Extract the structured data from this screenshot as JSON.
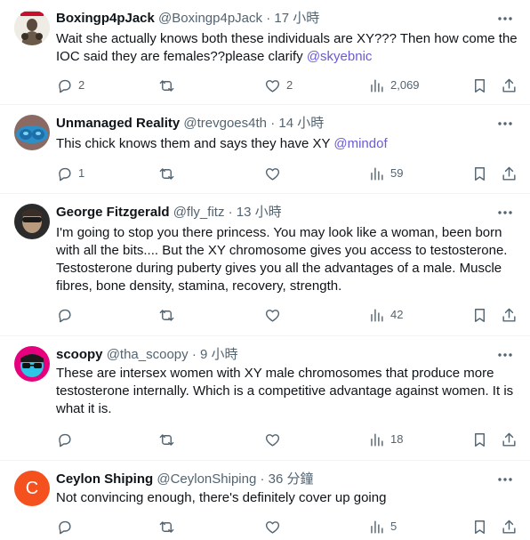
{
  "tweets": [
    {
      "name": "Boxingp4pJack",
      "handle": "@Boxingp4pJack",
      "sep": "·",
      "time": "17 小時",
      "text": "Wait she actually knows both these individuals are XY??? Then how come the IOC said they are females??please clarify ",
      "mention": "@skyebnic",
      "replies": "2",
      "retweets": "",
      "likes": "2",
      "views": "2,069"
    },
    {
      "name": "Unmanaged Reality",
      "handle": "@trevgoes4th",
      "sep": "·",
      "time": "14 小時",
      "text": "This chick knows them and says they have XY ",
      "mention": "@mindof",
      "replies": "1",
      "retweets": "",
      "likes": "",
      "views": "59"
    },
    {
      "name": "George Fitzgerald",
      "handle": "@fly_fitz",
      "sep": "·",
      "time": "13 小時",
      "text": "I'm going to stop you there princess. You may look like a woman, been born with all the bits.... But the XY chromosome gives you access to testosterone. Testosterone during puberty gives you all the advantages of a male. Muscle fibres, bone density, stamina, recovery, strength.",
      "mention": "",
      "replies": "",
      "retweets": "",
      "likes": "",
      "views": "42"
    },
    {
      "name": "scoopy",
      "handle": "@tha_scoopy",
      "sep": "·",
      "time": "9 小時",
      "text": "These are intersex women with XY male chromosomes that produce more testosterone internally. Which is a competitive advantage against women. It is what it is.",
      "mention": "",
      "replies": "",
      "retweets": "",
      "likes": "",
      "views": "18"
    },
    {
      "name": "Ceylon Shiping",
      "handle": "@CeylonShiping",
      "sep": "·",
      "time": "36 分鐘",
      "text": "Not convincing enough,  there's definitely cover up going",
      "mention": "",
      "replies": "",
      "retweets": "",
      "likes": "",
      "views": "5",
      "avatar_letter": "C"
    }
  ],
  "icons": {
    "more": "more-icon",
    "reply": "reply-icon",
    "retweet": "retweet-icon",
    "like": "like-icon",
    "views": "views-icon",
    "bookmark": "bookmark-icon",
    "share": "share-icon"
  },
  "colors": {
    "mention": "#6a5ad6",
    "secondary_text": "#536471",
    "avatar_orange": "#f4511e"
  }
}
